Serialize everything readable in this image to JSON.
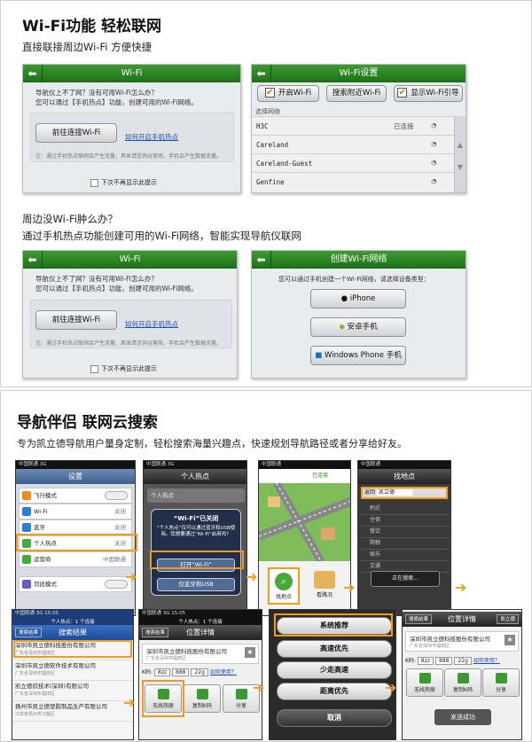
{
  "section1": {
    "title": "Wi-Fi功能  轻松联网",
    "subtitle": "直接联接周边Wi-Fi  方便快捷",
    "dialog1": {
      "title": "Wi-Fi",
      "q": "导航仪上不了网？没有可用Wi-Fi怎么办？",
      "a": "您可以通过【手机热点】功能，创建可用的Wi-Fi网络。",
      "button": "前往连接Wi-Fi",
      "link": "如何开启手机热点",
      "note": "注：通过手机热点联网会产生流量，具体请咨询运营商，手机会产生数据流量。",
      "checkbox": "下次不再显示此提示"
    },
    "wifi_settings": {
      "title": "Wi-Fi设置",
      "btn_open": "开启Wi-Fi",
      "btn_search": "搜索附近Wi-Fi",
      "btn_guide": "显示Wi-Fi引导",
      "section_label": "选择网络",
      "networks": [
        {
          "name": "H3C",
          "status": "已连接"
        },
        {
          "name": "Careland",
          "status": ""
        },
        {
          "name": "Careland-Guest",
          "status": ""
        },
        {
          "name": "Genfine",
          "status": ""
        }
      ]
    },
    "question": "周边没Wi-Fi肿么办？",
    "answer": "通过手机热点功能创建可用的Wi-Fi网络，智能实现导航仪联网",
    "create": {
      "title": "创建Wi-Fi网络",
      "prompt": "您可以通过手机创建一个Wi-Fi网络，请选择设备类型：",
      "opt1": "iPhone",
      "opt2": "安卓手机",
      "opt3": "Windows Phone 手机"
    }
  },
  "section2": {
    "title": "导航伴侣  联网云搜索",
    "subtitle": "专为凯立德导航用户量身定制，轻松搜索海量兴趣点，快速规划导航路径或者分享给好友。",
    "carrier": "中国联通",
    "net": "3G",
    "time": "15:05",
    "settings": {
      "title": "设置",
      "items": [
        {
          "label": "飞行模式",
          "value": ""
        },
        {
          "label": "Wi-Fi",
          "value": "关闭"
        },
        {
          "label": "蓝牙",
          "value": "关闭"
        },
        {
          "label": "个人热点",
          "value": "关闭"
        },
        {
          "label": "运营商",
          "value": "中国联通"
        },
        {
          "label": "勿扰模式",
          "value": ""
        }
      ]
    },
    "hotspot": {
      "title": "个人热点",
      "row": "个人热点",
      "alert_title": "“Wi-Fi”已关闭",
      "alert_body": "“个人热点”仅可以通过蓝牙和USB使用。您想要通过“Wi-Fi”启用吗？",
      "opt_on": "打开“Wi-Fi”",
      "opt_usb": "仅蓝牙和USB"
    },
    "map": {
      "status": "已连接",
      "find": "找地点",
      "look": "看路况"
    },
    "search": {
      "title": "找地点",
      "back": "返回",
      "query": "凯立德",
      "searching": "正在搜索...",
      "cats": [
        "附近",
        "住宿",
        "餐饮",
        "购物",
        "娱乐",
        "交通"
      ]
    },
    "results": {
      "status": "个人热点：1 个连接",
      "back": "搜索结果",
      "title": "搜索结果",
      "items": [
        {
          "name": "深圳市凯立德科技股份有限公司",
          "addr": "广东省深圳市福田区"
        },
        {
          "name": "深圳市凯立德软件技术有限公司",
          "addr": "广东省深圳市福田区"
        },
        {
          "name": "凯立德欣技术(深圳)有限公司",
          "addr": "广东省深圳市福田区"
        },
        {
          "name": "扬州市凯立德塑胶制品生产有限公司",
          "addr": "江苏省扬州市江都区"
        }
      ]
    },
    "detail": {
      "title": "位置详情",
      "back": "搜索结果",
      "home": "凯立德",
      "name": "深圳市凯立德科技股份有限公司",
      "addr": "广东省深圳市福田区",
      "kcode_label": "K码:",
      "kcode": [
        "8zz",
        "888",
        "22g"
      ],
      "how": "如何使用？",
      "act1": "无线热联",
      "act2": "复制K码",
      "act3": "分享"
    },
    "route": {
      "options": [
        "系统推荐",
        "高速优先",
        "少走高速",
        "距离优先"
      ],
      "cancel": "取消"
    },
    "sent": "发送成功"
  },
  "colors": {
    "green": "#2f8a24",
    "accent": "#f29a1a",
    "link": "#1a4fb3"
  }
}
